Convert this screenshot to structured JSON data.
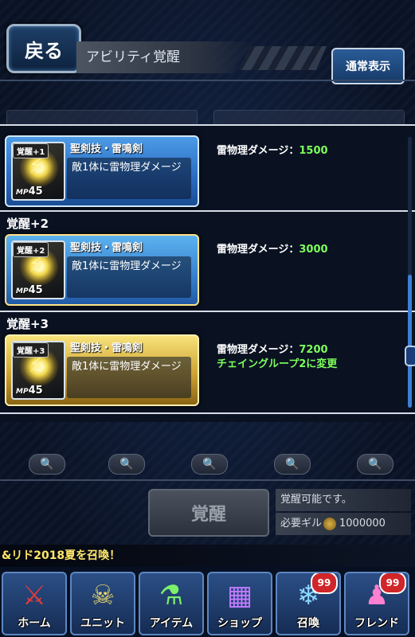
{
  "header": {
    "back_label": "戻る",
    "title": "アビリティ覚醒",
    "normal_view_label": "通常表示"
  },
  "entries": [
    {
      "level_label": "",
      "badge": "覚醒+1",
      "name": "聖剣技・雷鳴剣",
      "description": "敵1体に雷物理ダメージ",
      "mp_label": "MP",
      "mp_value": "45",
      "effect_label": "雷物理ダメージ：",
      "effect_value": "1500",
      "extra_effect": ""
    },
    {
      "level_label": "覚醒+2",
      "badge": "覚醒+2",
      "name": "聖剣技・雷鳴剣",
      "description": "敵1体に雷物理ダメージ",
      "mp_label": "MP",
      "mp_value": "45",
      "effect_label": "雷物理ダメージ：",
      "effect_value": "3000",
      "extra_effect": ""
    },
    {
      "level_label": "覚醒+3",
      "badge": "覚醒+3",
      "name": "聖剣技・雷鳴剣",
      "description": "敵1体に雷物理ダメージ",
      "mp_label": "MP",
      "mp_value": "45",
      "effect_label": "雷物理ダメージ：",
      "effect_value": "7200",
      "extra_effect": "チェイングループ2に変更"
    }
  ],
  "awaken": {
    "button_label": "覚醒",
    "status_text": "覚醒可能です。",
    "cost_label": "必要ギル",
    "cost_value": "1000000"
  },
  "banner_text": "&リド2018夏を召喚！",
  "nav": [
    {
      "label": "ホーム",
      "icon": "sword-icon",
      "badge": ""
    },
    {
      "label": "ユニット",
      "icon": "unit-icon",
      "badge": ""
    },
    {
      "label": "アイテム",
      "icon": "potion-icon",
      "badge": ""
    },
    {
      "label": "ショップ",
      "icon": "shop-icon",
      "badge": ""
    },
    {
      "label": "召喚",
      "icon": "crystal-icon",
      "badge": "99"
    },
    {
      "label": "フレンド",
      "icon": "friend-icon",
      "badge": "99"
    }
  ],
  "colors": {
    "accent_green": "#7dff5a",
    "banner_yellow": "#ffe86a",
    "badge_red": "#d0262a"
  }
}
